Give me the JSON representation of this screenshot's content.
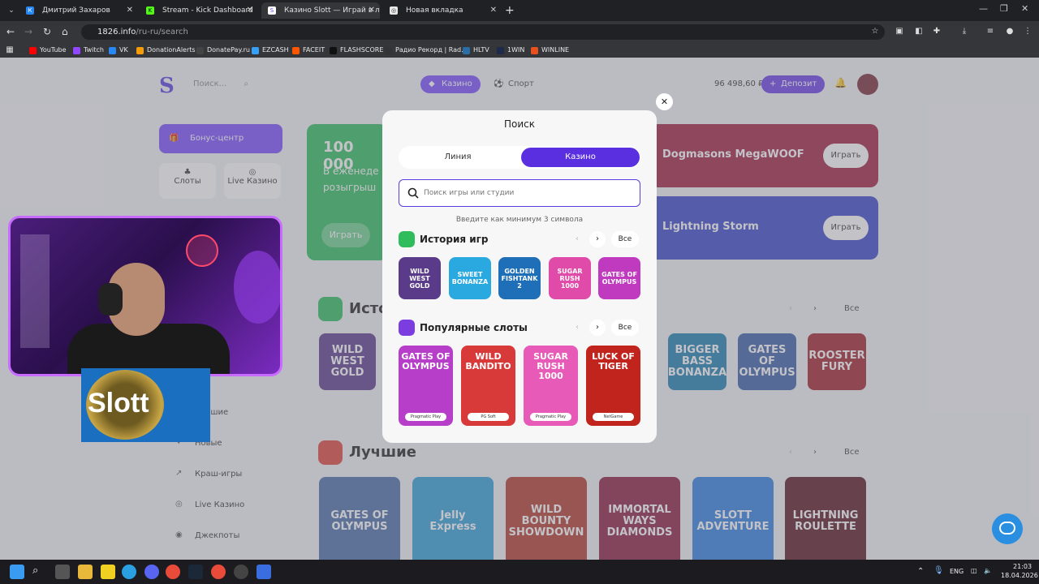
{
  "browser": {
    "tabs": [
      {
        "label": "Дмитрий Захаров",
        "icon": "vk-icon",
        "color": "#2787f5"
      },
      {
        "label": "Stream - Kick Dashboard",
        "icon": "kick-icon",
        "color": "#53fc18"
      },
      {
        "label": "Казино Slott — Играй в лучш…",
        "icon": "slott-icon",
        "color": "#ffffff"
      },
      {
        "label": "Новая вкладка",
        "icon": "chrome-icon",
        "color": "#e8e8e8"
      }
    ],
    "url_host": "1826.info",
    "url_path": "/ru-ru/search",
    "bookmarks": [
      {
        "label": "YouTube",
        "color": "#ff0000"
      },
      {
        "label": "Twitch",
        "color": "#9146ff"
      },
      {
        "label": "VK",
        "color": "#2787f5"
      },
      {
        "label": "DonationAlerts",
        "color": "#f59c07"
      },
      {
        "label": "DonatePay.ru",
        "color": "#444444"
      },
      {
        "label": "EZCASH",
        "color": "#35a0f5"
      },
      {
        "label": "FACEIT",
        "color": "#ff5500"
      },
      {
        "label": "FLASHSCORE",
        "color": "#111111"
      },
      {
        "label": "Радио Рекорд | Rad...",
        "color": "#333333"
      },
      {
        "label": "HLTV",
        "color": "#2b6ea6"
      },
      {
        "label": "1WIN",
        "color": "#1e2a4a"
      },
      {
        "label": "WINLINE",
        "color": "#e8501e"
      }
    ]
  },
  "site": {
    "logo": "S",
    "search_placeholder": "Поиск...",
    "nav_casino": "Казино",
    "nav_sport": "Спорт",
    "balance": "96 498,60 ₽",
    "deposit_label": "Депозит",
    "bonus_center": "Бонус-центр",
    "cat_slots": "Слоты",
    "cat_live": "Live Казино",
    "side_items": [
      "Лучшие",
      "Новые",
      "Краш-игры",
      "Live Казино",
      "Джекпоты"
    ],
    "banner_amount": "100 000",
    "banner_text_1": "В еженеде",
    "banner_text_2": "розыгрыш",
    "banner_play": "Играть",
    "banners_right": [
      {
        "title": "Dogmasons MegaWOOF",
        "btn": "Играть",
        "color": "#a3203e"
      },
      {
        "title": "Lightning Storm",
        "btn": "Играть",
        "color": "#3a46c8"
      }
    ],
    "section_history_partial": "Исто",
    "section_best": "Лучшие",
    "all_label": "Все",
    "history_tiles": [
      {
        "name": "WILD WEST GOLD",
        "color": "#5a3b8a"
      },
      {
        "name": "BIGGER BASS BONANZA",
        "color": "#1d7fb0"
      },
      {
        "name": "GATES OF OLYMPUS",
        "color": "#3a5fa8"
      },
      {
        "name": "ROOSTER FURY",
        "color": "#a3202a"
      }
    ],
    "best_tiles": [
      {
        "name": "GATES OF OLYMPUS",
        "color": "#4a6eaa"
      },
      {
        "name": "Jelly Express",
        "color": "#2f9ed8"
      },
      {
        "name": "WILD BOUNTY SHOWDOWN",
        "color": "#b23a2a"
      },
      {
        "name": "IMMORTAL WAYS DIAMONDS",
        "color": "#8a1c3c"
      },
      {
        "name": "SLOTT ADVENTURE",
        "color": "#2f7fe0"
      },
      {
        "name": "LIGHTNING ROULETTE",
        "color": "#5a1420"
      }
    ]
  },
  "modal": {
    "title": "Поиск",
    "tab_line": "Линия",
    "tab_casino": "Казино",
    "search_placeholder": "Поиск игры или студии",
    "hint": "Введите как минимум 3 символа",
    "history_title": "История игр",
    "popular_title": "Популярные слоты",
    "all_label": "Все",
    "history_games": [
      {
        "name": "WILD WEST GOLD",
        "color": "#5a3b8a"
      },
      {
        "name": "SWEET BONANZA",
        "color": "#2aa8e0"
      },
      {
        "name": "GOLDEN FISHTANK 2",
        "color": "#1e6fb8"
      },
      {
        "name": "SUGAR RUSH 1000",
        "color": "#e04aa8"
      },
      {
        "name": "GATES OF OLYMPUS",
        "color": "#c03ac0"
      }
    ],
    "popular_games": [
      {
        "name": "GATES OF OLYMPUS",
        "provider": "Pragmatic Play",
        "color": "#b63ec8"
      },
      {
        "name": "WILD BANDITO",
        "provider": "PG Soft",
        "color": "#d83a3a"
      },
      {
        "name": "SUGAR RUSH 1000",
        "provider": "Pragmatic Play",
        "color": "#e85ab8"
      },
      {
        "name": "LUCK OF TIGER",
        "provider": "NetGame",
        "color": "#c0241c"
      }
    ]
  },
  "overlay": {
    "brand": "Slott"
  },
  "taskbar": {
    "lang": "ENG",
    "time": "21:03",
    "date": "18.04.2026"
  }
}
